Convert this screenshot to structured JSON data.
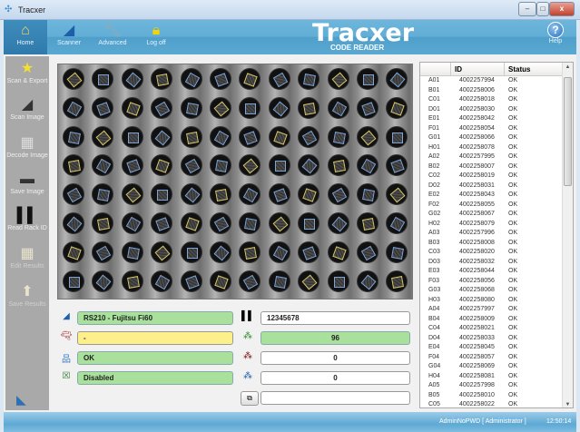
{
  "window": {
    "title": "Tracxer",
    "minimize": "–",
    "maximize": "□",
    "close": "x"
  },
  "header": {
    "buttons": [
      {
        "label": "Home",
        "icon": "home-icon"
      },
      {
        "label": "Scanner",
        "icon": "scanner-icon"
      },
      {
        "label": "Advanced",
        "icon": "wrench-icon"
      },
      {
        "label": "Log off",
        "icon": "lock-icon"
      }
    ],
    "logo": "Tracxer",
    "logo_sub": "CODE READER",
    "help": "Help"
  },
  "sidebar": {
    "items": [
      {
        "label": "Scan & Export",
        "icon": "star-icon"
      },
      {
        "label": "Scan Image",
        "icon": "scanner-icon"
      },
      {
        "label": "Decode Image",
        "icon": "decode-icon"
      },
      {
        "label": "Save Image",
        "icon": "image-icon"
      },
      {
        "label": "Read Rack ID",
        "icon": "barcode-icon"
      },
      {
        "label": "Edit Results",
        "icon": "grid-edit-icon"
      },
      {
        "label": "Save Results",
        "icon": "save-results-icon"
      }
    ]
  },
  "rack": {
    "rows": 8,
    "cols": 12
  },
  "status": {
    "scanner": "RS210 - Fujitsu Fi60",
    "reader": "-",
    "connection": "OK",
    "export": "Disabled",
    "rack_id": "12345678",
    "decoded": "96",
    "failed": "0",
    "empty": "0",
    "copy_value": ""
  },
  "table": {
    "headers": [
      "ID",
      "Status"
    ],
    "rows": [
      [
        "A01",
        "4002257994",
        "OK"
      ],
      [
        "B01",
        "4002258006",
        "OK"
      ],
      [
        "C01",
        "4002258018",
        "OK"
      ],
      [
        "D01",
        "4002258030",
        "OK"
      ],
      [
        "E01",
        "4002258042",
        "OK"
      ],
      [
        "F01",
        "4002258054",
        "OK"
      ],
      [
        "G01",
        "4002258066",
        "OK"
      ],
      [
        "H01",
        "4002258078",
        "OK"
      ],
      [
        "A02",
        "4002257995",
        "OK"
      ],
      [
        "B02",
        "4002258007",
        "OK"
      ],
      [
        "C02",
        "4002258019",
        "OK"
      ],
      [
        "D02",
        "4002258031",
        "OK"
      ],
      [
        "E02",
        "4002258043",
        "OK"
      ],
      [
        "F02",
        "4002258055",
        "OK"
      ],
      [
        "G02",
        "4002258067",
        "OK"
      ],
      [
        "H02",
        "4002258079",
        "OK"
      ],
      [
        "A03",
        "4002257996",
        "OK"
      ],
      [
        "B03",
        "4002258008",
        "OK"
      ],
      [
        "C03",
        "4002258020",
        "OK"
      ],
      [
        "D03",
        "4002258032",
        "OK"
      ],
      [
        "E03",
        "4002258044",
        "OK"
      ],
      [
        "F03",
        "4002258056",
        "OK"
      ],
      [
        "G03",
        "4002258068",
        "OK"
      ],
      [
        "H03",
        "4002258080",
        "OK"
      ],
      [
        "A04",
        "4002257997",
        "OK"
      ],
      [
        "B04",
        "4002258009",
        "OK"
      ],
      [
        "C04",
        "4002258021",
        "OK"
      ],
      [
        "D04",
        "4002258033",
        "OK"
      ],
      [
        "E04",
        "4002258045",
        "OK"
      ],
      [
        "F04",
        "4002258057",
        "OK"
      ],
      [
        "G04",
        "4002258069",
        "OK"
      ],
      [
        "H04",
        "4002258081",
        "OK"
      ],
      [
        "A05",
        "4002257998",
        "OK"
      ],
      [
        "B05",
        "4002258010",
        "OK"
      ],
      [
        "C05",
        "4002258022",
        "OK"
      ]
    ]
  },
  "footer": {
    "user": "AdminNoPWD  [ Administrator ]",
    "time": "12:50:14"
  }
}
